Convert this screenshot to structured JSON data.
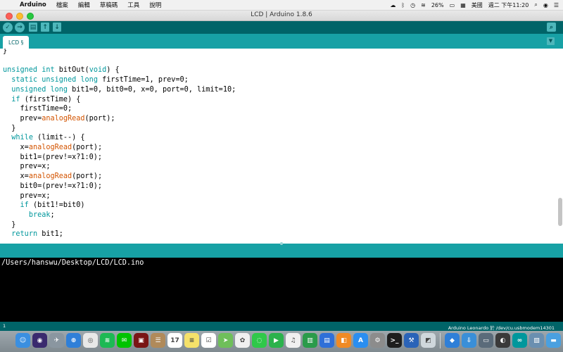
{
  "menubar": {
    "apple": "",
    "app": "Arduino",
    "items": [
      "檔案",
      "編輯",
      "草稿碼",
      "工具",
      "說明"
    ],
    "battery": "26%",
    "input_method": "美國",
    "clock": "週二 下午11:20"
  },
  "window": {
    "title": "LCD | Arduino 1.8.6"
  },
  "toolbar": {
    "verify_icon": "✓",
    "upload_icon": "→",
    "new_icon": "▤",
    "open_icon": "↑",
    "save_icon": "↓",
    "serial_icon": "⌕"
  },
  "tab": {
    "label": "LCD §",
    "menu_icon": "▼"
  },
  "code_lines": [
    [
      {
        "t": "}"
      }
    ],
    [
      {
        "t": ""
      }
    ],
    [
      {
        "t": "unsigned int",
        "c": "kw"
      },
      {
        "t": " bitOut("
      },
      {
        "t": "void",
        "c": "kw"
      },
      {
        "t": ") {"
      }
    ],
    [
      {
        "t": "  "
      },
      {
        "t": "static unsigned long",
        "c": "kw"
      },
      {
        "t": " firstTime=1, prev=0;"
      }
    ],
    [
      {
        "t": "  "
      },
      {
        "t": "unsigned long",
        "c": "kw"
      },
      {
        "t": " bit1=0, bit0=0, x=0, port=0, limit=10;"
      }
    ],
    [
      {
        "t": "  "
      },
      {
        "t": "if",
        "c": "kw"
      },
      {
        "t": " (firstTime) {"
      }
    ],
    [
      {
        "t": "    firstTime=0;"
      }
    ],
    [
      {
        "t": "    prev="
      },
      {
        "t": "analogRead",
        "c": "fn"
      },
      {
        "t": "(port);"
      }
    ],
    [
      {
        "t": "  }"
      }
    ],
    [
      {
        "t": "  "
      },
      {
        "t": "while",
        "c": "kw"
      },
      {
        "t": " (limit--) {"
      }
    ],
    [
      {
        "t": "    x="
      },
      {
        "t": "analogRead",
        "c": "fn"
      },
      {
        "t": "(port);"
      }
    ],
    [
      {
        "t": "    bit1=(prev!=x?1:0);"
      }
    ],
    [
      {
        "t": "    prev=x;"
      }
    ],
    [
      {
        "t": "    x="
      },
      {
        "t": "analogRead",
        "c": "fn"
      },
      {
        "t": "(port);"
      }
    ],
    [
      {
        "t": "    bit0=(prev!=x?1:0);"
      }
    ],
    [
      {
        "t": "    prev=x;"
      }
    ],
    [
      {
        "t": "    "
      },
      {
        "t": "if",
        "c": "kw"
      },
      {
        "t": " (bit1!=bit0)"
      }
    ],
    [
      {
        "t": "      "
      },
      {
        "t": "break",
        "c": "kw"
      },
      {
        "t": ";"
      }
    ],
    [
      {
        "t": "  }"
      }
    ],
    [
      {
        "t": "  "
      },
      {
        "t": "return",
        "c": "kw"
      },
      {
        "t": " bit1;"
      }
    ]
  ],
  "console": {
    "text": "/Users/hanswu/Desktop/LCD/LCD.ino"
  },
  "status": {
    "line_number": "1",
    "board": "Arduino Leonardo 於 /dev/cu.usbmodem14301"
  },
  "dock": {
    "apps": [
      {
        "name": "finder-icon",
        "bg": "#3b8fe0",
        "glyph": "☺"
      },
      {
        "name": "siri-icon",
        "bg": "#3a2a6e",
        "glyph": "◉"
      },
      {
        "name": "launchpad-icon",
        "bg": "#8a96a0",
        "glyph": "✈"
      },
      {
        "name": "safari-icon",
        "bg": "#2f7fd8",
        "glyph": "⊕"
      },
      {
        "name": "chrome-icon",
        "bg": "#e8e8e8",
        "glyph": "◎"
      },
      {
        "name": "spotify-icon",
        "bg": "#1db954",
        "glyph": "≋"
      },
      {
        "name": "line-icon",
        "bg": "#00c300",
        "glyph": "✉"
      },
      {
        "name": "photo-booth-icon",
        "bg": "#7a1515",
        "glyph": "▣"
      },
      {
        "name": "contacts-icon",
        "bg": "#b08a5a",
        "glyph": "☰"
      },
      {
        "name": "calendar-icon",
        "bg": "#ffffff",
        "glyph": "17"
      },
      {
        "name": "notes-icon",
        "bg": "#f5e16a",
        "glyph": "≡"
      },
      {
        "name": "reminders-icon",
        "bg": "#ffffff",
        "glyph": "☑"
      },
      {
        "name": "maps-icon",
        "bg": "#6fbf5a",
        "glyph": "➤"
      },
      {
        "name": "photos-icon",
        "bg": "#f0f0f0",
        "glyph": "✿"
      },
      {
        "name": "messages-icon",
        "bg": "#2fc84a",
        "glyph": "◌"
      },
      {
        "name": "facetime-icon",
        "bg": "#2bb24c",
        "glyph": "▶"
      },
      {
        "name": "itunes-icon",
        "bg": "#f0f0f0",
        "glyph": "♫"
      },
      {
        "name": "numbers-icon",
        "bg": "#2a9b4a",
        "glyph": "▥"
      },
      {
        "name": "keynote-icon",
        "bg": "#2f6fd8",
        "glyph": "▤"
      },
      {
        "name": "books-icon",
        "bg": "#f08a24",
        "glyph": "◧"
      },
      {
        "name": "app-store-icon",
        "bg": "#2a8ef0",
        "glyph": "A"
      },
      {
        "name": "system-preferences-icon",
        "bg": "#8c8c8c",
        "glyph": "⚙"
      },
      {
        "name": "terminal-icon",
        "bg": "#1e1e1e",
        "glyph": ">_"
      },
      {
        "name": "xcode-icon",
        "bg": "#2a63b8",
        "glyph": "⚒"
      },
      {
        "name": "preview-icon",
        "bg": "#cfd7dc",
        "glyph": "◩"
      }
    ],
    "apps_right": [
      {
        "name": "unknown-app-icon",
        "bg": "#2f7fd8",
        "glyph": "◆"
      },
      {
        "name": "downloads-stack-icon",
        "bg": "#3a8fd8",
        "glyph": "⇩"
      },
      {
        "name": "screen-sharing-icon",
        "bg": "#5a6b7a",
        "glyph": "▭"
      },
      {
        "name": "magnifier-icon",
        "bg": "#3a3a3a",
        "glyph": "◐"
      },
      {
        "name": "arduino-icon",
        "bg": "#00979c",
        "glyph": "∞"
      },
      {
        "name": "images-icon",
        "bg": "#6a8fb0",
        "glyph": "▧"
      },
      {
        "name": "folder-icon",
        "bg": "#4aa0e0",
        "glyph": "▬"
      },
      {
        "name": "trash-icon",
        "bg": "#c8cfd4",
        "glyph": "🗑"
      }
    ]
  }
}
